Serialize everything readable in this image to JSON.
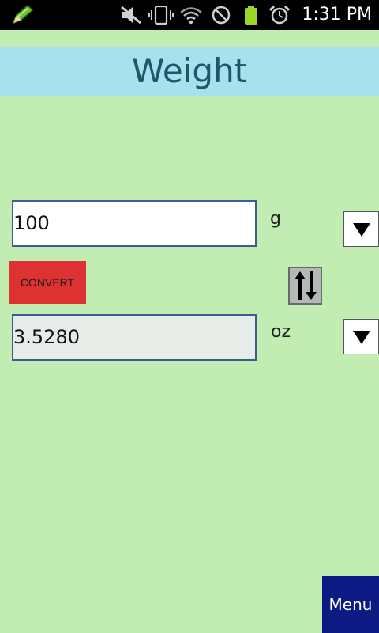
{
  "status_bar": {
    "time": "1:31 PM",
    "icons": [
      "pencil-icon",
      "mute-icon",
      "vibrate-icon",
      "wifi-icon",
      "no-sim-icon",
      "battery-icon",
      "alarm-icon"
    ]
  },
  "app": {
    "title": "Weight"
  },
  "converter": {
    "from_value": "100",
    "from_unit": "g",
    "to_value": "3.5280",
    "to_unit": "oz",
    "convert_label": "CONVERT"
  },
  "menu": {
    "label": "Menu"
  },
  "colors": {
    "background": "#c2edb2",
    "title_band": "#a9e0ee",
    "title_text": "#1b5869",
    "convert_button": "#dd3232",
    "menu_button": "#0d1a84",
    "field_border": "#3e5c8f"
  }
}
